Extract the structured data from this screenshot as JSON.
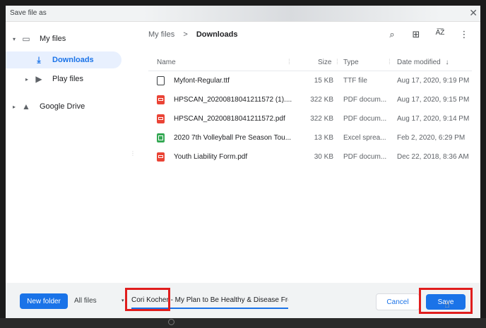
{
  "dialog": {
    "title": "Save file as",
    "close_glyph": "✕"
  },
  "nav": {
    "items": [
      {
        "label": "My files",
        "icon": "laptop-icon",
        "glyph": "▭",
        "chevron": "▾",
        "level": 0
      },
      {
        "label": "Downloads",
        "icon": "download-icon",
        "glyph": "⤓",
        "chevron": "",
        "level": 1,
        "active": true
      },
      {
        "label": "Play files",
        "icon": "play-files-icon",
        "glyph": "▶",
        "chevron": "▸",
        "level": 1
      },
      {
        "label": "Google Drive",
        "icon": "google-drive-icon",
        "glyph": "▲",
        "chevron": "▸",
        "level": 0
      }
    ]
  },
  "breadcrumb": {
    "parent": "My files",
    "separator": ">",
    "current": "Downloads"
  },
  "toolbar": {
    "search_glyph": "⌕",
    "grid_glyph": "⊞",
    "sort_glyph": "A͞Z",
    "more_glyph": "⋮"
  },
  "columns": {
    "name": "Name",
    "size": "Size",
    "type": "Type",
    "date": "Date modified",
    "sort_arrow": "↓"
  },
  "files": [
    {
      "name": "Myfont-Regular.ttf",
      "size": "15 KB",
      "type": "TTF file",
      "date": "Aug 17, 2020, 9:19 PM",
      "icon": "doc"
    },
    {
      "name": "HPSCAN_20200818041211572 (1)....",
      "size": "322 KB",
      "type": "PDF docum...",
      "date": "Aug 17, 2020, 9:15 PM",
      "icon": "pdf"
    },
    {
      "name": "HPSCAN_20200818041211572.pdf",
      "size": "322 KB",
      "type": "PDF docum...",
      "date": "Aug 17, 2020, 9:14 PM",
      "icon": "pdf"
    },
    {
      "name": "2020 7th Volleyball Pre Season Tou...",
      "size": "13 KB",
      "type": "Excel sprea...",
      "date": "Feb 2, 2020, 6:29 PM",
      "icon": "sheet"
    },
    {
      "name": "Youth Liability Form.pdf",
      "size": "30 KB",
      "type": "PDF docum...",
      "date": "Dec 22, 2018, 8:36 AM",
      "icon": "pdf"
    }
  ],
  "bottom": {
    "new_folder": "New folder",
    "filter": "All files",
    "filter_caret": "▾",
    "filename_value": "Cori Kocher - My Plan to Be Healthy & Disease Free for a",
    "cancel": "Cancel",
    "save": "Save"
  },
  "colors": {
    "accent": "#1a73e8",
    "highlight_box": "#e01d1d",
    "pdf": "#ea4335",
    "sheet": "#34a853"
  }
}
